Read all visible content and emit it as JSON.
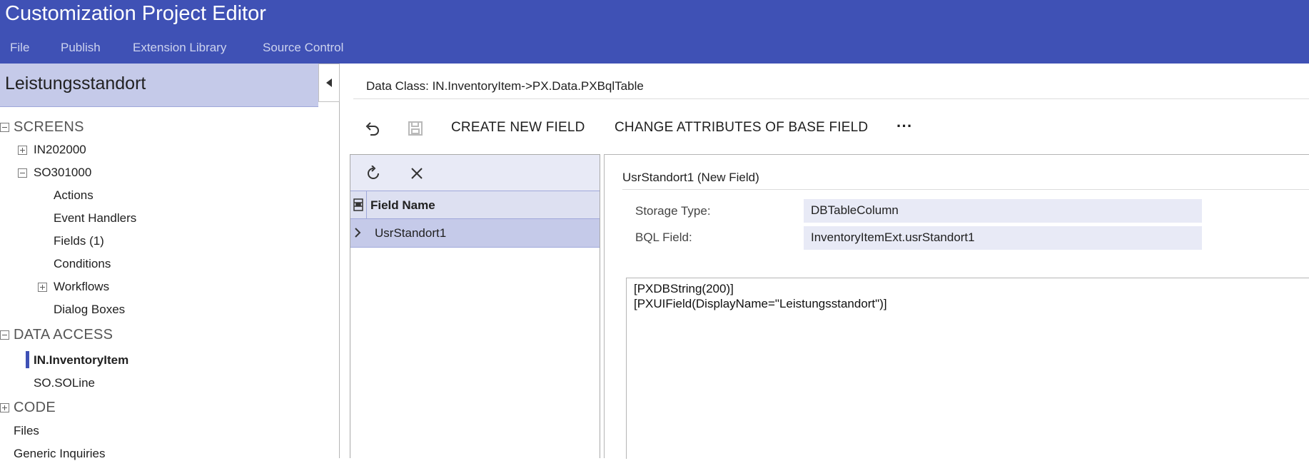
{
  "app": {
    "title": "Customization Project Editor"
  },
  "menu": [
    "File",
    "Publish",
    "Extension Library",
    "Source Control"
  ],
  "sidebar": {
    "project_name": "Leistungsstandort",
    "screens_label": "SCREENS",
    "screens": [
      {
        "label": "IN202000"
      },
      {
        "label": "SO301000"
      }
    ],
    "so_children": [
      "Actions",
      "Event Handlers",
      "Fields (1)",
      "Conditions",
      "Workflows",
      "Dialog Boxes"
    ],
    "data_access_label": "DATA ACCESS",
    "data_access": [
      "IN.InventoryItem",
      "SO.SOLine"
    ],
    "code_label": "CODE",
    "other": [
      "Files",
      "Generic Inquiries"
    ]
  },
  "main": {
    "data_class": "Data Class: IN.InventoryItem->PX.Data.PXBqlTable",
    "toolbar": {
      "create_new_field": "CREATE NEW FIELD",
      "change_attributes": "CHANGE ATTRIBUTES OF BASE FIELD",
      "more": "···"
    },
    "grid": {
      "column_header": "Field Name",
      "rows": [
        "UsrStandort1"
      ]
    },
    "detail": {
      "title": "UsrStandort1 (New Field)",
      "storage_type_label": "Storage Type:",
      "storage_type_value": "DBTableColumn",
      "bql_field_label": "BQL Field:",
      "bql_field_value": "InventoryItemExt.usrStandort1",
      "code_lines": [
        "[PXDBString(200)]",
        "[PXUIField(DisplayName=\"Leistungsstandort\")]"
      ]
    }
  },
  "colors": {
    "header": "#3f51b5",
    "selection": "#c5cae9",
    "accent": "#3f51b5"
  }
}
